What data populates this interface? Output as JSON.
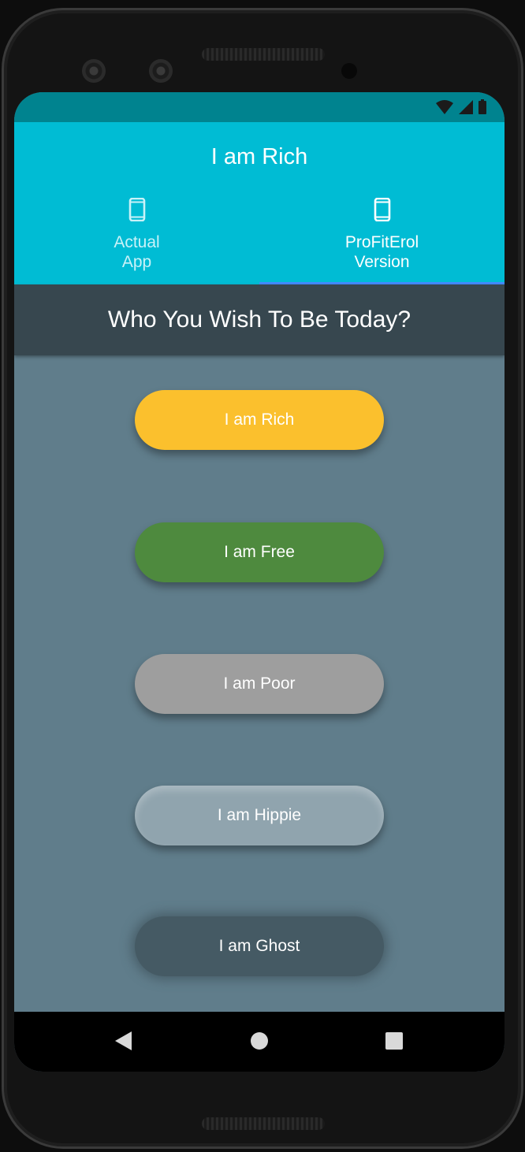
{
  "app": {
    "title": "I am Rich"
  },
  "tabs": [
    {
      "label": "Actual\nApp",
      "icon": "phone-icon",
      "active": false
    },
    {
      "label": "ProFitErol\nVersion",
      "icon": "phone-icon",
      "active": true
    }
  ],
  "subheader": {
    "text": "Who You Wish To Be Today?"
  },
  "buttons": {
    "rich": "I am Rich",
    "free": "I am Free",
    "poor": "I am Poor",
    "hippie": "I am Hippie",
    "ghost": "I am Ghost"
  },
  "colors": {
    "appbar": "#00bcd4",
    "statusbar": "#00838f",
    "subheader": "#37474f",
    "background": "#607d8b",
    "rich": "#fbc02d",
    "free": "#4e8a3e",
    "poor": "#9e9e9e",
    "hippie": "#90a4ae",
    "ghost": "#455a64",
    "tab_indicator": "#448aff"
  },
  "navigation": {
    "back": "back-icon",
    "home": "home-icon",
    "recents": "recents-icon"
  },
  "status_icons": [
    "wifi-icon",
    "signal-icon",
    "battery-icon"
  ]
}
